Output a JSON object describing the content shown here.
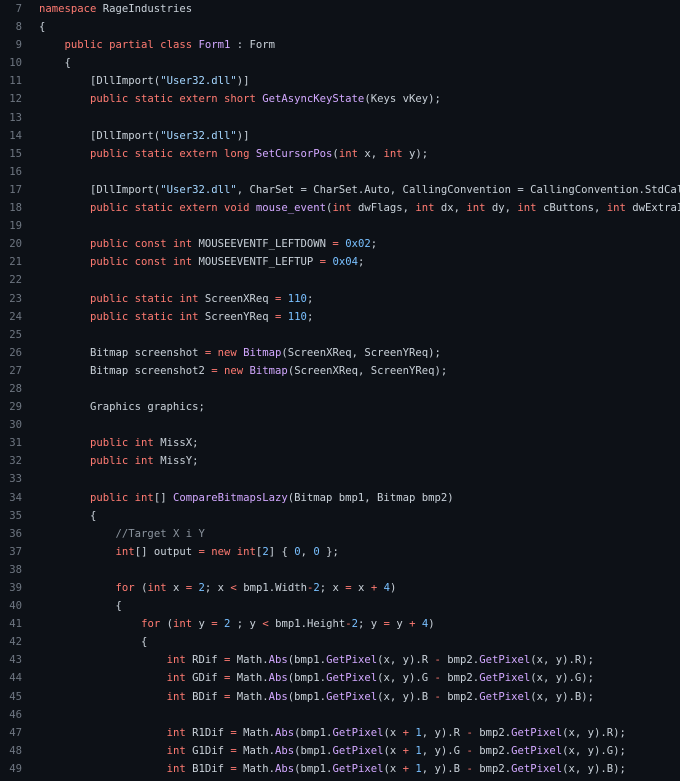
{
  "colors": {
    "background": "#0d1117",
    "line_number": "#6e7681",
    "plain": "#c9d1d9",
    "keyword": "#ff7b72",
    "function": "#d2a8ff",
    "string": "#a5d6ff",
    "number": "#79c0ff",
    "comment": "#8b949e"
  },
  "lines": [
    {
      "n": "7",
      "tokens": [
        [
          "kw",
          "namespace"
        ],
        [
          "pl",
          " RageIndustries"
        ]
      ]
    },
    {
      "n": "8",
      "tokens": [
        [
          "pl",
          "{"
        ]
      ]
    },
    {
      "n": "9",
      "tokens": [
        [
          "pl",
          "    "
        ],
        [
          "kw",
          "public partial class"
        ],
        [
          "pl",
          " "
        ],
        [
          "fn",
          "Form1"
        ],
        [
          "pl",
          " : Form"
        ]
      ]
    },
    {
      "n": "10",
      "tokens": [
        [
          "pl",
          "    {"
        ]
      ]
    },
    {
      "n": "11",
      "tokens": [
        [
          "pl",
          "        [DllImport("
        ],
        [
          "str",
          "\"User32.dll\""
        ],
        [
          "pl",
          ")]"
        ]
      ]
    },
    {
      "n": "12",
      "tokens": [
        [
          "pl",
          "        "
        ],
        [
          "kw",
          "public static extern short"
        ],
        [
          "pl",
          " "
        ],
        [
          "fn",
          "GetAsyncKeyState"
        ],
        [
          "pl",
          "(Keys vKey);"
        ]
      ]
    },
    {
      "n": "13",
      "tokens": []
    },
    {
      "n": "14",
      "tokens": [
        [
          "pl",
          "        [DllImport("
        ],
        [
          "str",
          "\"User32.dll\""
        ],
        [
          "pl",
          ")]"
        ]
      ]
    },
    {
      "n": "15",
      "tokens": [
        [
          "pl",
          "        "
        ],
        [
          "kw",
          "public static extern long"
        ],
        [
          "pl",
          " "
        ],
        [
          "fn",
          "SetCursorPos"
        ],
        [
          "pl",
          "("
        ],
        [
          "kw",
          "int"
        ],
        [
          "pl",
          " x, "
        ],
        [
          "kw",
          "int"
        ],
        [
          "pl",
          " y);"
        ]
      ]
    },
    {
      "n": "16",
      "tokens": []
    },
    {
      "n": "17",
      "tokens": [
        [
          "pl",
          "        [DllImport("
        ],
        [
          "str",
          "\"User32.dll\""
        ],
        [
          "pl",
          ", CharSet = CharSet.Auto, CallingConvention = CallingConvention.StdCall)]"
        ]
      ]
    },
    {
      "n": "18",
      "tokens": [
        [
          "pl",
          "        "
        ],
        [
          "kw",
          "public static extern void"
        ],
        [
          "pl",
          " "
        ],
        [
          "fn",
          "mouse_event"
        ],
        [
          "pl",
          "("
        ],
        [
          "kw",
          "int"
        ],
        [
          "pl",
          " dwFlags, "
        ],
        [
          "kw",
          "int"
        ],
        [
          "pl",
          " dx, "
        ],
        [
          "kw",
          "int"
        ],
        [
          "pl",
          " dy, "
        ],
        [
          "kw",
          "int"
        ],
        [
          "pl",
          " cButtons, "
        ],
        [
          "kw",
          "int"
        ],
        [
          "pl",
          " dwExtraInfo);"
        ]
      ]
    },
    {
      "n": "19",
      "tokens": []
    },
    {
      "n": "20",
      "tokens": [
        [
          "pl",
          "        "
        ],
        [
          "kw",
          "public const int"
        ],
        [
          "pl",
          " MOUSEEVENTF_LEFTDOWN "
        ],
        [
          "kw",
          "="
        ],
        [
          "pl",
          " "
        ],
        [
          "num",
          "0x02"
        ],
        [
          "pl",
          ";"
        ]
      ]
    },
    {
      "n": "21",
      "tokens": [
        [
          "pl",
          "        "
        ],
        [
          "kw",
          "public const int"
        ],
        [
          "pl",
          " MOUSEEVENTF_LEFTUP "
        ],
        [
          "kw",
          "="
        ],
        [
          "pl",
          " "
        ],
        [
          "num",
          "0x04"
        ],
        [
          "pl",
          ";"
        ]
      ]
    },
    {
      "n": "22",
      "tokens": []
    },
    {
      "n": "23",
      "tokens": [
        [
          "pl",
          "        "
        ],
        [
          "kw",
          "public static int"
        ],
        [
          "pl",
          " ScreenXReq "
        ],
        [
          "kw",
          "="
        ],
        [
          "pl",
          " "
        ],
        [
          "num",
          "110"
        ],
        [
          "pl",
          ";"
        ]
      ]
    },
    {
      "n": "24",
      "tokens": [
        [
          "pl",
          "        "
        ],
        [
          "kw",
          "public static int"
        ],
        [
          "pl",
          " ScreenYReq "
        ],
        [
          "kw",
          "="
        ],
        [
          "pl",
          " "
        ],
        [
          "num",
          "110"
        ],
        [
          "pl",
          ";"
        ]
      ]
    },
    {
      "n": "25",
      "tokens": []
    },
    {
      "n": "26",
      "tokens": [
        [
          "pl",
          "        Bitmap screenshot "
        ],
        [
          "kw",
          "="
        ],
        [
          "pl",
          " "
        ],
        [
          "kw",
          "new"
        ],
        [
          "pl",
          " "
        ],
        [
          "fn",
          "Bitmap"
        ],
        [
          "pl",
          "(ScreenXReq, ScreenYReq);"
        ]
      ]
    },
    {
      "n": "27",
      "tokens": [
        [
          "pl",
          "        Bitmap screenshot2 "
        ],
        [
          "kw",
          "="
        ],
        [
          "pl",
          " "
        ],
        [
          "kw",
          "new"
        ],
        [
          "pl",
          " "
        ],
        [
          "fn",
          "Bitmap"
        ],
        [
          "pl",
          "(ScreenXReq, ScreenYReq);"
        ]
      ]
    },
    {
      "n": "28",
      "tokens": []
    },
    {
      "n": "29",
      "tokens": [
        [
          "pl",
          "        Graphics graphics;"
        ]
      ]
    },
    {
      "n": "30",
      "tokens": []
    },
    {
      "n": "31",
      "tokens": [
        [
          "pl",
          "        "
        ],
        [
          "kw",
          "public int"
        ],
        [
          "pl",
          " MissX;"
        ]
      ]
    },
    {
      "n": "32",
      "tokens": [
        [
          "pl",
          "        "
        ],
        [
          "kw",
          "public int"
        ],
        [
          "pl",
          " MissY;"
        ]
      ]
    },
    {
      "n": "33",
      "tokens": []
    },
    {
      "n": "34",
      "tokens": [
        [
          "pl",
          "        "
        ],
        [
          "kw",
          "public int"
        ],
        [
          "pl",
          "[] "
        ],
        [
          "fn",
          "CompareBitmapsLazy"
        ],
        [
          "pl",
          "(Bitmap bmp1, Bitmap bmp2)"
        ]
      ]
    },
    {
      "n": "35",
      "tokens": [
        [
          "pl",
          "        {"
        ]
      ]
    },
    {
      "n": "36",
      "tokens": [
        [
          "pl",
          "            "
        ],
        [
          "cmt",
          "//Target X i Y"
        ]
      ]
    },
    {
      "n": "37",
      "tokens": [
        [
          "pl",
          "            "
        ],
        [
          "kw",
          "int"
        ],
        [
          "pl",
          "[] output "
        ],
        [
          "kw",
          "="
        ],
        [
          "pl",
          " "
        ],
        [
          "kw",
          "new"
        ],
        [
          "pl",
          " "
        ],
        [
          "kw",
          "int"
        ],
        [
          "pl",
          "["
        ],
        [
          "num",
          "2"
        ],
        [
          "pl",
          "] { "
        ],
        [
          "num",
          "0"
        ],
        [
          "pl",
          ", "
        ],
        [
          "num",
          "0"
        ],
        [
          "pl",
          " };"
        ]
      ]
    },
    {
      "n": "38",
      "tokens": []
    },
    {
      "n": "39",
      "tokens": [
        [
          "pl",
          "            "
        ],
        [
          "kw",
          "for"
        ],
        [
          "pl",
          " ("
        ],
        [
          "kw",
          "int"
        ],
        [
          "pl",
          " x "
        ],
        [
          "kw",
          "="
        ],
        [
          "pl",
          " "
        ],
        [
          "num",
          "2"
        ],
        [
          "pl",
          "; x "
        ],
        [
          "kw",
          "<"
        ],
        [
          "pl",
          " bmp1.Width"
        ],
        [
          "kw",
          "-"
        ],
        [
          "num",
          "2"
        ],
        [
          "pl",
          "; x "
        ],
        [
          "kw",
          "="
        ],
        [
          "pl",
          " x "
        ],
        [
          "kw",
          "+"
        ],
        [
          "pl",
          " "
        ],
        [
          "num",
          "4"
        ],
        [
          "pl",
          ")"
        ]
      ]
    },
    {
      "n": "40",
      "tokens": [
        [
          "pl",
          "            {"
        ]
      ]
    },
    {
      "n": "41",
      "tokens": [
        [
          "pl",
          "                "
        ],
        [
          "kw",
          "for"
        ],
        [
          "pl",
          " ("
        ],
        [
          "kw",
          "int"
        ],
        [
          "pl",
          " y "
        ],
        [
          "kw",
          "="
        ],
        [
          "pl",
          " "
        ],
        [
          "num",
          "2"
        ],
        [
          "pl",
          " ; y "
        ],
        [
          "kw",
          "<"
        ],
        [
          "pl",
          " bmp1.Height"
        ],
        [
          "kw",
          "-"
        ],
        [
          "num",
          "2"
        ],
        [
          "pl",
          "; y "
        ],
        [
          "kw",
          "="
        ],
        [
          "pl",
          " y "
        ],
        [
          "kw",
          "+"
        ],
        [
          "pl",
          " "
        ],
        [
          "num",
          "4"
        ],
        [
          "pl",
          ")"
        ]
      ]
    },
    {
      "n": "42",
      "tokens": [
        [
          "pl",
          "                {"
        ]
      ]
    },
    {
      "n": "43",
      "tokens": [
        [
          "pl",
          "                    "
        ],
        [
          "kw",
          "int"
        ],
        [
          "pl",
          " RDif "
        ],
        [
          "kw",
          "="
        ],
        [
          "pl",
          " Math."
        ],
        [
          "fn",
          "Abs"
        ],
        [
          "pl",
          "(bmp1."
        ],
        [
          "fn",
          "GetPixel"
        ],
        [
          "pl",
          "(x, y).R "
        ],
        [
          "kw",
          "-"
        ],
        [
          "pl",
          " bmp2."
        ],
        [
          "fn",
          "GetPixel"
        ],
        [
          "pl",
          "(x, y).R);"
        ]
      ]
    },
    {
      "n": "44",
      "tokens": [
        [
          "pl",
          "                    "
        ],
        [
          "kw",
          "int"
        ],
        [
          "pl",
          " GDif "
        ],
        [
          "kw",
          "="
        ],
        [
          "pl",
          " Math."
        ],
        [
          "fn",
          "Abs"
        ],
        [
          "pl",
          "(bmp1."
        ],
        [
          "fn",
          "GetPixel"
        ],
        [
          "pl",
          "(x, y).G "
        ],
        [
          "kw",
          "-"
        ],
        [
          "pl",
          " bmp2."
        ],
        [
          "fn",
          "GetPixel"
        ],
        [
          "pl",
          "(x, y).G);"
        ]
      ]
    },
    {
      "n": "45",
      "tokens": [
        [
          "pl",
          "                    "
        ],
        [
          "kw",
          "int"
        ],
        [
          "pl",
          " BDif "
        ],
        [
          "kw",
          "="
        ],
        [
          "pl",
          " Math."
        ],
        [
          "fn",
          "Abs"
        ],
        [
          "pl",
          "(bmp1."
        ],
        [
          "fn",
          "GetPixel"
        ],
        [
          "pl",
          "(x, y).B "
        ],
        [
          "kw",
          "-"
        ],
        [
          "pl",
          " bmp2."
        ],
        [
          "fn",
          "GetPixel"
        ],
        [
          "pl",
          "(x, y).B);"
        ]
      ]
    },
    {
      "n": "46",
      "tokens": []
    },
    {
      "n": "47",
      "tokens": [
        [
          "pl",
          "                    "
        ],
        [
          "kw",
          "int"
        ],
        [
          "pl",
          " R1Dif "
        ],
        [
          "kw",
          "="
        ],
        [
          "pl",
          " Math."
        ],
        [
          "fn",
          "Abs"
        ],
        [
          "pl",
          "(bmp1."
        ],
        [
          "fn",
          "GetPixel"
        ],
        [
          "pl",
          "(x "
        ],
        [
          "kw",
          "+"
        ],
        [
          "pl",
          " "
        ],
        [
          "num",
          "1"
        ],
        [
          "pl",
          ", y).R "
        ],
        [
          "kw",
          "-"
        ],
        [
          "pl",
          " bmp2."
        ],
        [
          "fn",
          "GetPixel"
        ],
        [
          "pl",
          "(x, y).R);"
        ]
      ]
    },
    {
      "n": "48",
      "tokens": [
        [
          "pl",
          "                    "
        ],
        [
          "kw",
          "int"
        ],
        [
          "pl",
          " G1Dif "
        ],
        [
          "kw",
          "="
        ],
        [
          "pl",
          " Math."
        ],
        [
          "fn",
          "Abs"
        ],
        [
          "pl",
          "(bmp1."
        ],
        [
          "fn",
          "GetPixel"
        ],
        [
          "pl",
          "(x "
        ],
        [
          "kw",
          "+"
        ],
        [
          "pl",
          " "
        ],
        [
          "num",
          "1"
        ],
        [
          "pl",
          ", y).G "
        ],
        [
          "kw",
          "-"
        ],
        [
          "pl",
          " bmp2."
        ],
        [
          "fn",
          "GetPixel"
        ],
        [
          "pl",
          "(x, y).G);"
        ]
      ]
    },
    {
      "n": "49",
      "tokens": [
        [
          "pl",
          "                    "
        ],
        [
          "kw",
          "int"
        ],
        [
          "pl",
          " B1Dif "
        ],
        [
          "kw",
          "="
        ],
        [
          "pl",
          " Math."
        ],
        [
          "fn",
          "Abs"
        ],
        [
          "pl",
          "(bmp1."
        ],
        [
          "fn",
          "GetPixel"
        ],
        [
          "pl",
          "(x "
        ],
        [
          "kw",
          "+"
        ],
        [
          "pl",
          " "
        ],
        [
          "num",
          "1"
        ],
        [
          "pl",
          ", y).B "
        ],
        [
          "kw",
          "-"
        ],
        [
          "pl",
          " bmp2."
        ],
        [
          "fn",
          "GetPixel"
        ],
        [
          "pl",
          "(x, y).B);"
        ]
      ]
    }
  ]
}
